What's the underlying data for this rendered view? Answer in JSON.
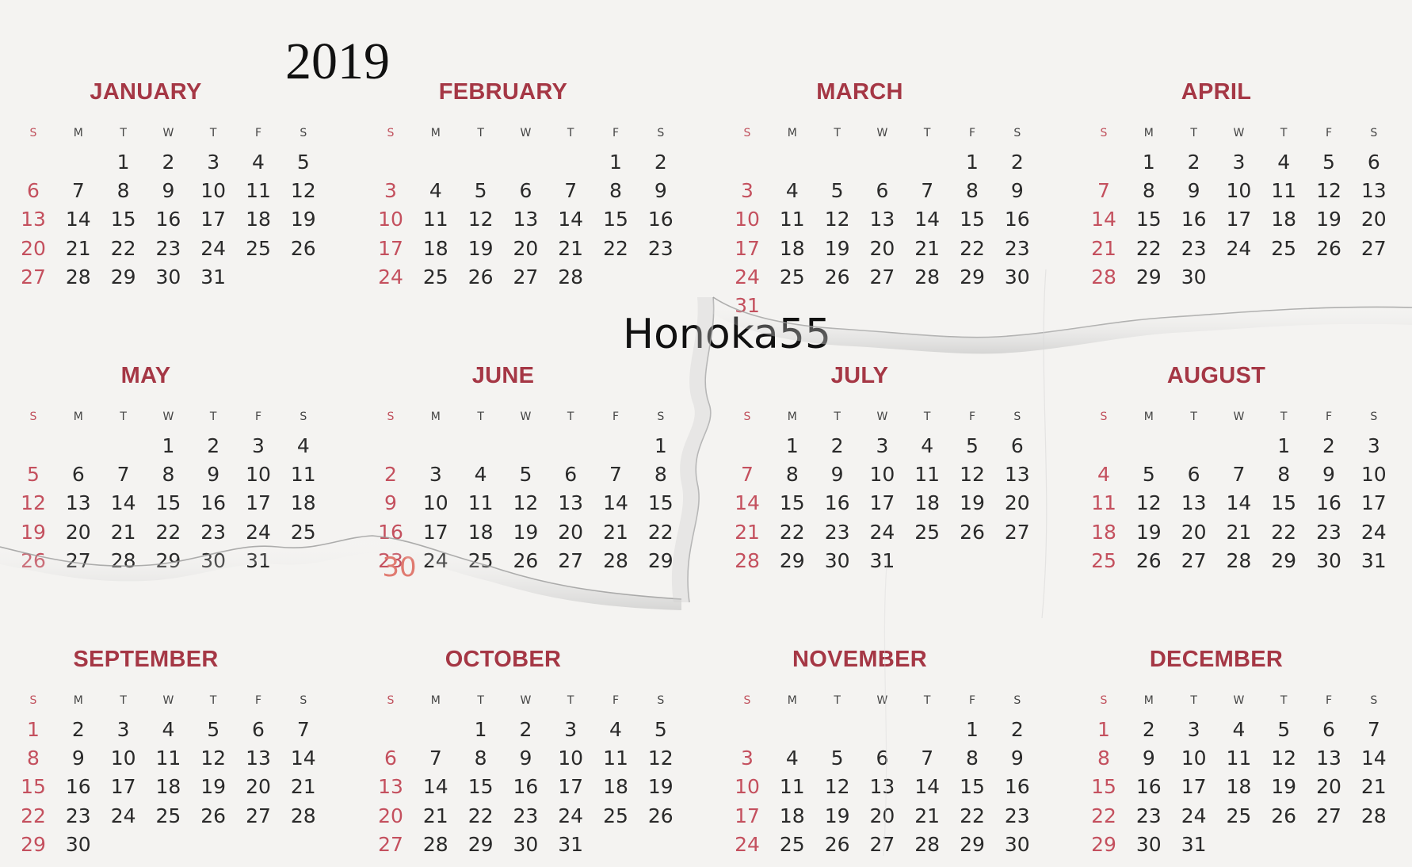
{
  "year": "2019",
  "watermark": "Honoka55",
  "weekday_headers": [
    "S",
    "M",
    "T",
    "W",
    "T",
    "F",
    "S"
  ],
  "months": [
    {
      "name": "JANUARY",
      "start": 2,
      "days": 31
    },
    {
      "name": "FEBRUARY",
      "start": 5,
      "days": 28
    },
    {
      "name": "MARCH",
      "start": 5,
      "days": 31
    },
    {
      "name": "APRIL",
      "start": 1,
      "days": 30
    },
    {
      "name": "MAY",
      "start": 3,
      "days": 31
    },
    {
      "name": "JUNE",
      "start": 6,
      "days": 29
    },
    {
      "name": "JULY",
      "start": 1,
      "days": 31
    },
    {
      "name": "AUGUST",
      "start": 4,
      "days": 31
    },
    {
      "name": "SEPTEMBER",
      "start": 0,
      "days": 30
    },
    {
      "name": "OCTOBER",
      "start": 2,
      "days": 31
    },
    {
      "name": "NOVEMBER",
      "start": 5,
      "days": 30
    },
    {
      "name": "DECEMBER",
      "start": 0,
      "days": 31
    }
  ],
  "june_extra_day": "30",
  "colors": {
    "month_title": "#a53745",
    "sunday": "#c4505e",
    "day_text": "#2a2a2a",
    "extra_day": "#e07a70"
  }
}
